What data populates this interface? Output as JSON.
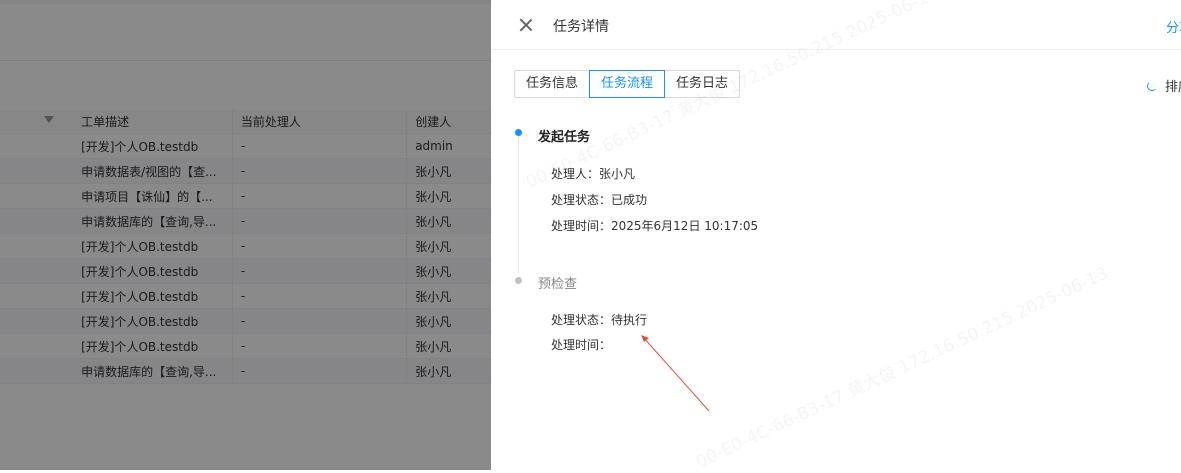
{
  "background": {
    "table": {
      "headers": [
        "工单描述",
        "当前处理人",
        "创建人"
      ],
      "rows": [
        [
          "[开发]个人OB.testdb",
          "-",
          "admin"
        ],
        [
          "申请数据表/视图的【查...",
          "-",
          "张小凡"
        ],
        [
          "申请项目【诛仙】的【...",
          "-",
          "张小凡"
        ],
        [
          "申请数据库的【查询,导...",
          "-",
          "张小凡"
        ],
        [
          "[开发]个人OB.testdb",
          "-",
          "张小凡"
        ],
        [
          "[开发]个人OB.testdb",
          "-",
          "张小凡"
        ],
        [
          "[开发]个人OB.testdb",
          "-",
          "张小凡"
        ],
        [
          "[开发]个人OB.testdb",
          "-",
          "张小凡"
        ],
        [
          "[开发]个人OB.testdb",
          "-",
          "张小凡"
        ],
        [
          "申请数据库的【查询,导...",
          "-",
          "张小凡"
        ]
      ]
    }
  },
  "drawer": {
    "title": "任务详情",
    "share_label": "分享",
    "sort_label": "排序",
    "tabs": [
      "任务信息",
      "任务流程",
      "任务日志"
    ],
    "active_tab": "任务流程",
    "timeline": [
      {
        "title": "发起任务",
        "rows": [
          "处理人：张小凡",
          "处理状态：已成功",
          "处理时间：2025年6月12日 10:17:05"
        ]
      },
      {
        "title": "预检查",
        "rows": [
          "处理状态：待执行",
          "处理时间："
        ]
      }
    ]
  },
  "watermark": "00-E0-4C-66-B3-17 黄大俊 172.16.50.215 2025-06-13",
  "colors": {
    "accent": "#1890ff",
    "annotation_arrow": "#e0533d"
  }
}
